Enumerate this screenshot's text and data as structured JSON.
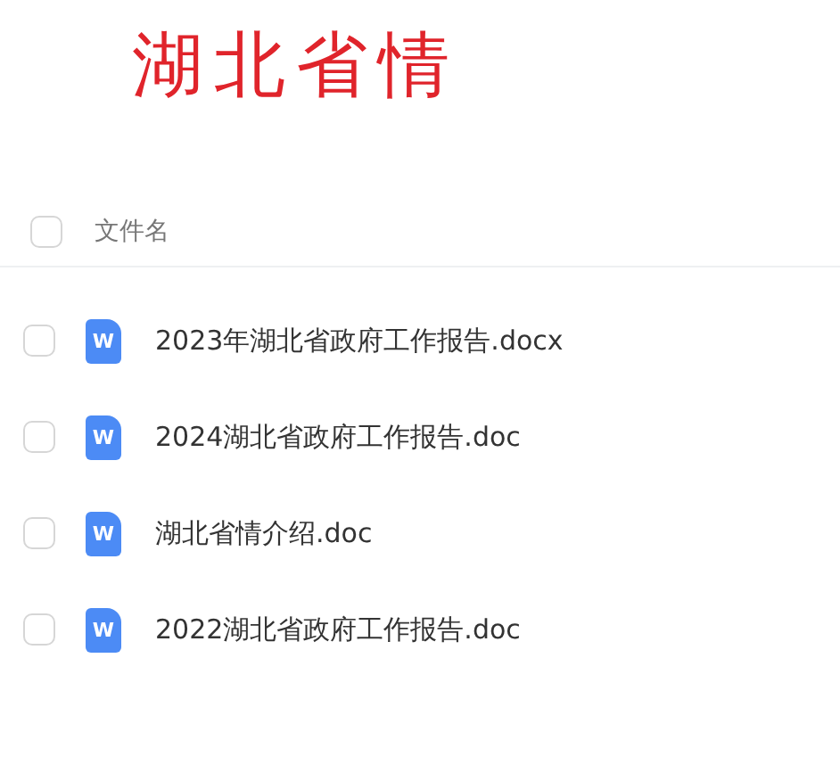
{
  "title": "湖北省情",
  "header": {
    "checked": false,
    "column_label": "文件名"
  },
  "files": [
    {
      "name": "2023年湖北省政府工作报告.docx",
      "icon_label": "W",
      "checked": false
    },
    {
      "name": "2024湖北省政府工作报告.doc",
      "icon_label": "W",
      "checked": false
    },
    {
      "name": "湖北省情介绍.doc",
      "icon_label": "W",
      "checked": false
    },
    {
      "name": "2022湖北省政府工作报告.doc",
      "icon_label": "W",
      "checked": false
    }
  ]
}
